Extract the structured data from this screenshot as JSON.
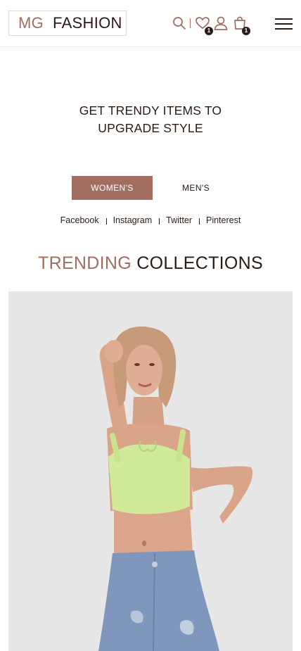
{
  "header": {
    "logo_prefix": "MG",
    "logo_name": "FASHION",
    "icons": [
      "search-icon",
      "heart-icon",
      "user-icon",
      "shopping-bag-icon",
      "menu-icon"
    ],
    "wishlist_count": "1",
    "cart_count": "1"
  },
  "hero": {
    "line1": "GET TRENDY ITEMS TO",
    "line2": "UPGRADE STYLE"
  },
  "tabs": [
    {
      "label": "WOMEN'S",
      "active": true
    },
    {
      "label": "MEN'S",
      "active": false
    }
  ],
  "social": [
    "Facebook",
    "Instagram",
    "Twitter",
    "Pinterest"
  ],
  "section": {
    "title_accent": "TRENDING",
    "title_main": "COLLECTIONS"
  },
  "colors": {
    "accent": "#a36e62",
    "text": "#2b1b14",
    "image_bg": "#e7e7e7"
  }
}
